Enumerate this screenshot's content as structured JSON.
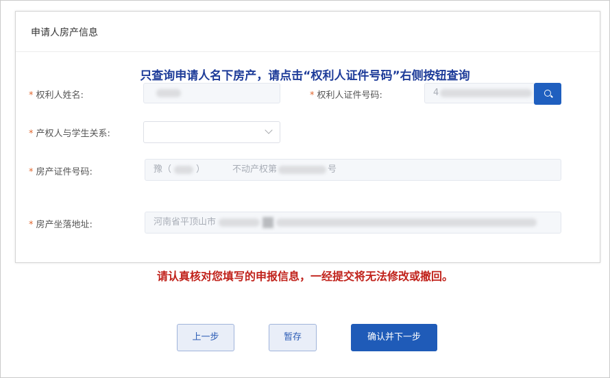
{
  "card": {
    "title": "申请人房产信息"
  },
  "notice_top": "只查询申请人名下房产，请点击“权利人证件号码”右侧按钮查询",
  "form": {
    "required_mark": "*",
    "owner_name_label": "权利人姓名:",
    "owner_id_label": "权利人证件号码:",
    "relation_label": "产权人与学生关系:",
    "relation_value": "",
    "cert_label": "房产证件号码:",
    "cert_part1": "豫（",
    "cert_part2": "）",
    "cert_part3": "不动产权第",
    "cert_part4": "号",
    "address_label": "房产坐落地址:",
    "address_value": "河南省平顶山市",
    "owner_id_prefix": "4"
  },
  "notice_bottom": "请认真核对您填写的申报信息，一经提交将无法修改或撤回。",
  "buttons": {
    "prev": "上一步",
    "save": "暂存",
    "next": "确认并下一步"
  },
  "colors": {
    "primary": "#1f5bb8",
    "notice_blue": "#1e3c99",
    "notice_red": "#c0211a",
    "required": "#e0672f"
  },
  "icons": {
    "search": "search-icon",
    "dropdown": "chevron-down-icon"
  }
}
